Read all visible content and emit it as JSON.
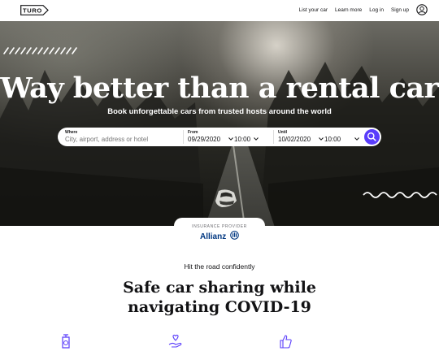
{
  "header": {
    "logo_text": "TURO",
    "nav": [
      "List your car",
      "Learn more",
      "Log in",
      "Sign up"
    ],
    "profile_icon": "user-circle-icon"
  },
  "hero": {
    "title": "Way better than a rental car",
    "subtitle": "Book unforgettable cars from trusted hosts around the world"
  },
  "search": {
    "where_label": "Where",
    "where_placeholder": "City, airport, address or hotel",
    "from_label": "From",
    "from_date": "09/29/2020",
    "from_time": "10:00",
    "until_label": "Until",
    "until_date": "10/02/2020",
    "until_time": "10:00",
    "button_icon": "search-icon"
  },
  "insurance": {
    "label": "INSURANCE PROVIDER",
    "provider": "Allianz"
  },
  "section": {
    "kicker": "Hit the road confidently",
    "title": "Safe car sharing while navigating COVID-19"
  },
  "colors": {
    "accent": "#593cfb",
    "text": "#121214",
    "allianz": "#003781"
  }
}
